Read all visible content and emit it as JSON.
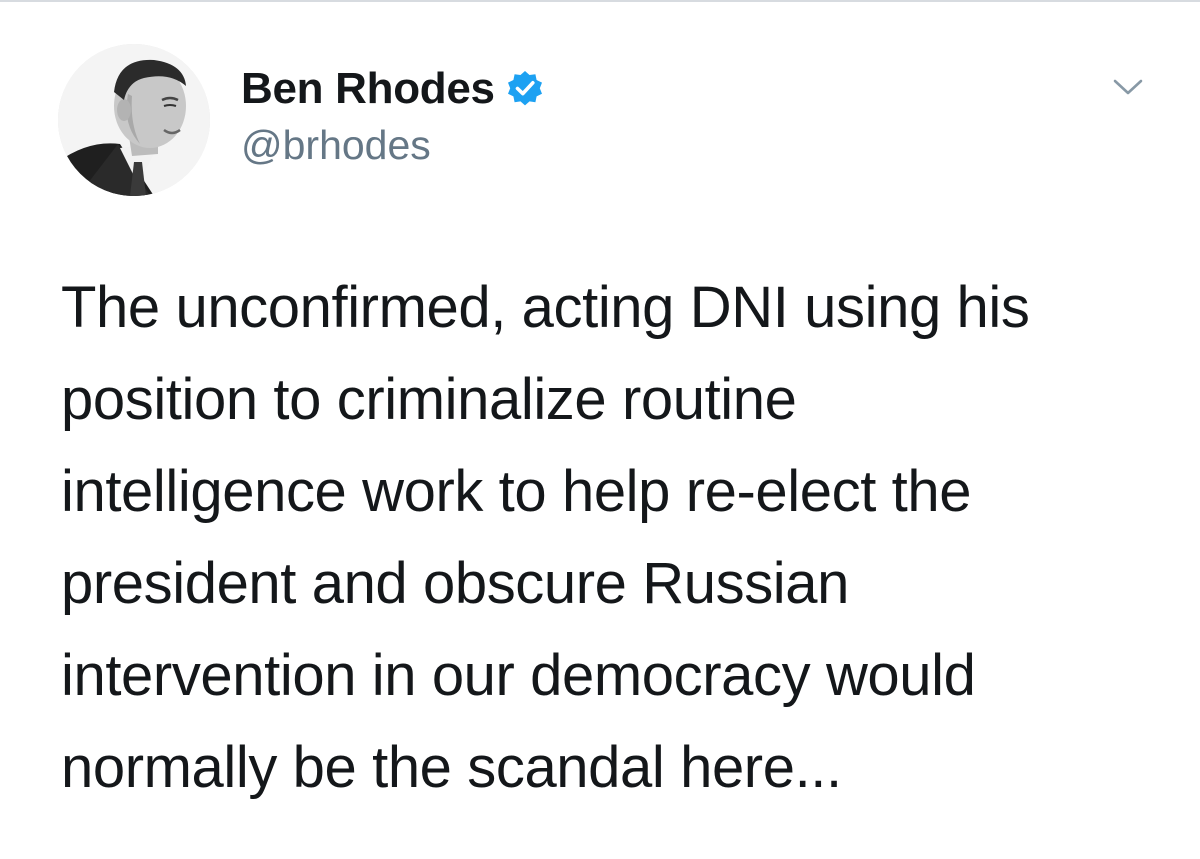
{
  "tweet": {
    "author": {
      "display_name": "Ben Rhodes",
      "handle": "@brhodes",
      "verified": true,
      "avatar_icon": "profile-photo"
    },
    "text": "The unconfirmed, acting DNI using his\nposition to criminalize routine\nintelligence work to help re-elect the\npresident and obscure Russian\nintervention in our democracy would\nnormally be the scandal here...",
    "menu_icon": "chevron-down-icon"
  },
  "colors": {
    "verified_badge": "#1da1f2",
    "handle": "#657786",
    "text": "#14171a",
    "divider": "#d7dbe0"
  }
}
